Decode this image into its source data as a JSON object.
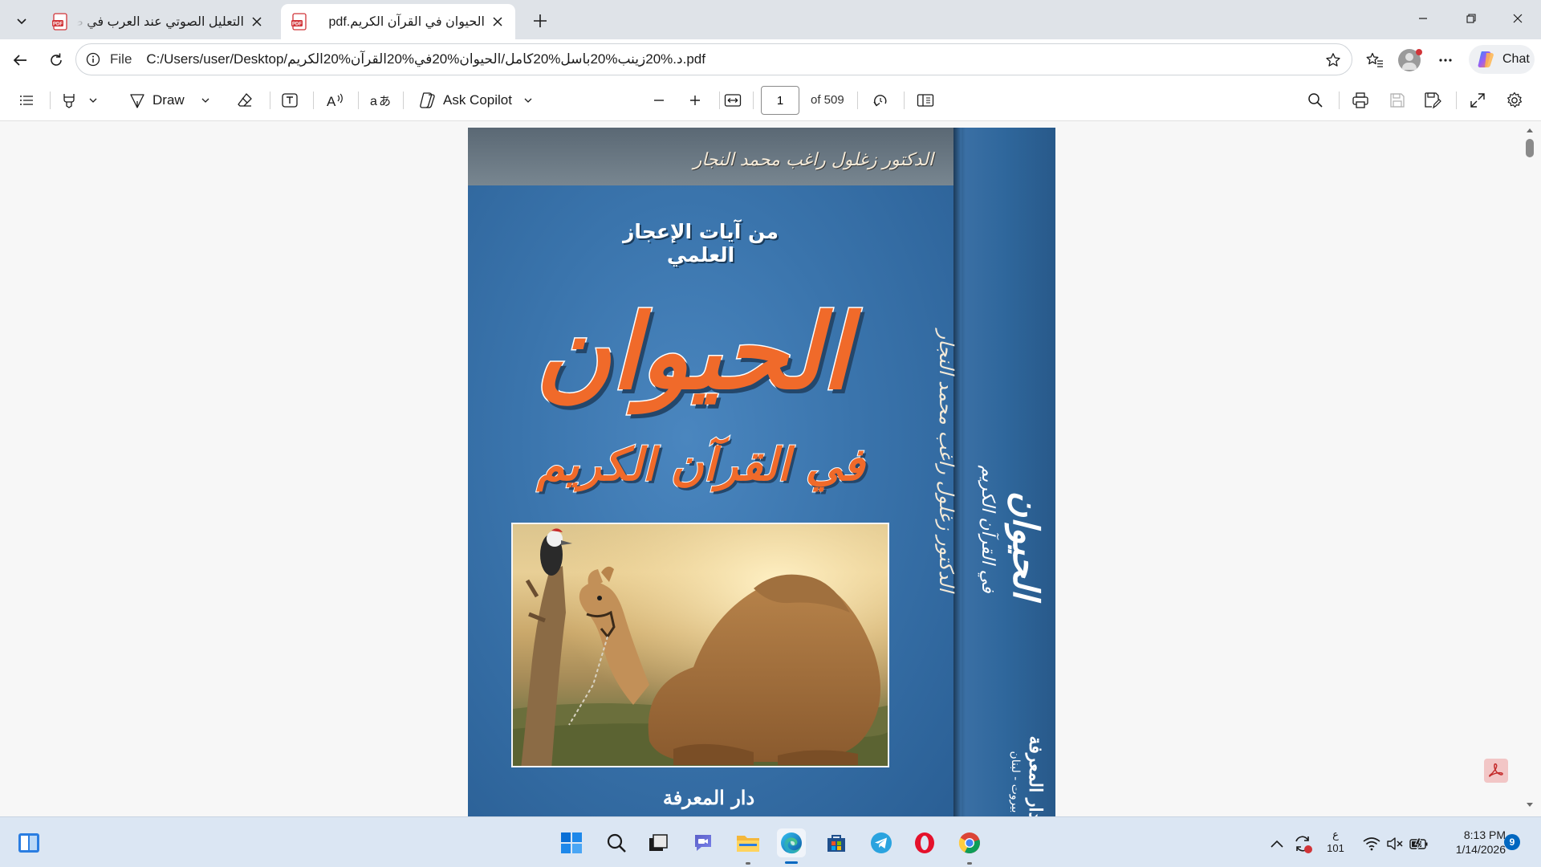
{
  "browser": {
    "tabs": [
      {
        "title": "التعليل الصوتي عند العرب في ضوء",
        "icon": "pdf-file-icon",
        "active": false
      },
      {
        "title": "الحيوان في القرآن الكريم.pdf",
        "icon": "pdf-file-icon",
        "active": true
      }
    ],
    "address": {
      "scheme": "File",
      "url": "C:/Users/user/Desktop/د.%20زينب%20باسل%20كامل/الحيوان%20في%20القرآن%20الكريم.pdf"
    },
    "chat_label": "Chat"
  },
  "pdf_toolbar": {
    "draw_label": "Draw",
    "ask_copilot_label": "Ask Copilot",
    "current_page": "1",
    "page_total": "of 509"
  },
  "cover": {
    "top_author": "الدكتور زغلول راغب محمد النجار",
    "series": "من آيات الإعجاز العلمي",
    "title": "الحيوان",
    "subtitle": "في القرآن الكريم",
    "publisher": "دار المعرفة",
    "spine_author": "الدكتور زغلول راغب محمد النجار",
    "spine_title": "الحيوان",
    "spine_subtitle": "في القرآن الكريم",
    "spine_publisher": "دار المعرفة",
    "spine_city": "بيروت - لبنان"
  },
  "taskbar": {
    "lang_top": "ع",
    "lang_bottom": "101",
    "time": "8:13 PM",
    "date": "1/14/2026",
    "notification_count": "9"
  },
  "colors": {
    "accent": "#0067c0",
    "pdf_red": "#d13438",
    "cover_blue": "#3a74ac",
    "cover_orange": "#f06a2a"
  }
}
